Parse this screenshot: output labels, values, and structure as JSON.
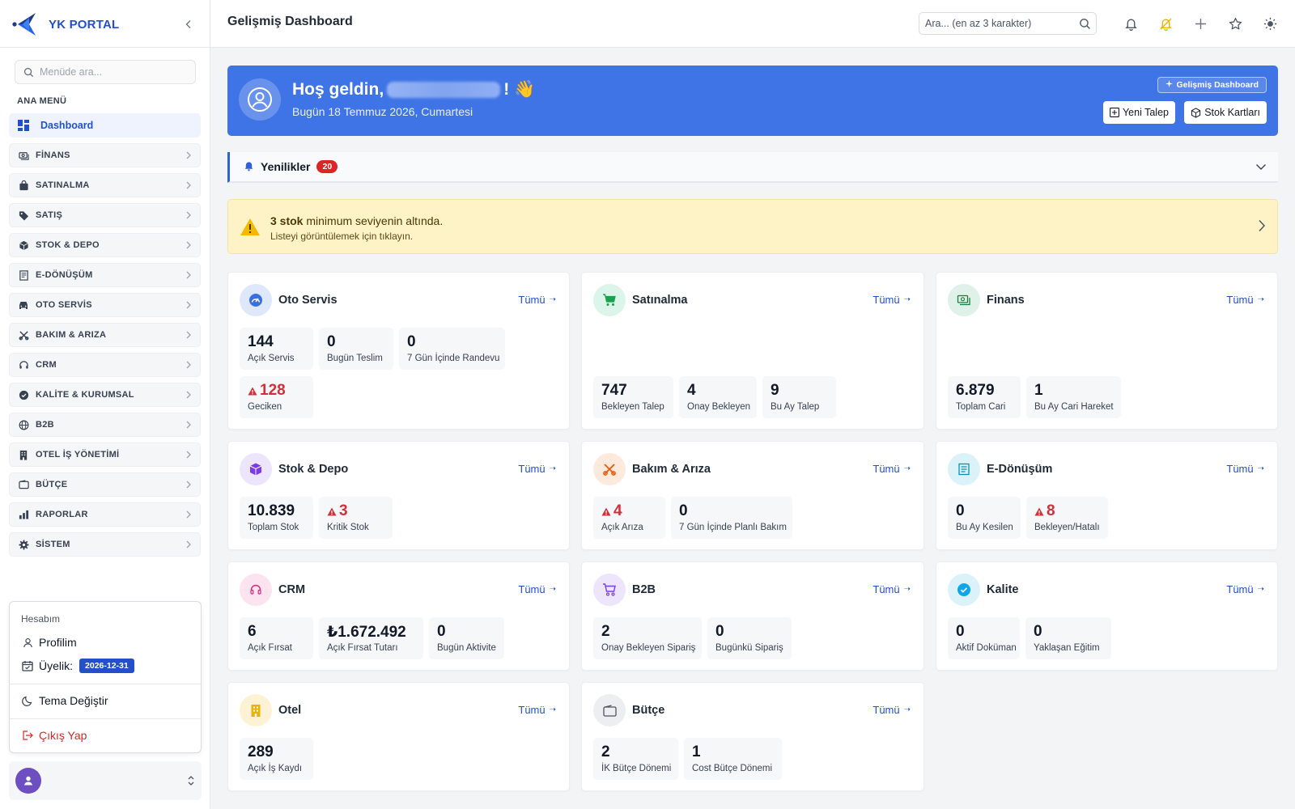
{
  "brand": {
    "name": "YK PORTAL"
  },
  "sidebar": {
    "search_placeholder": "Menüde ara...",
    "section_title": "ANA MENÜ",
    "items": [
      {
        "label": "Dashboard",
        "icon": "grid-icon"
      },
      {
        "label": "FİNANS",
        "icon": "money-icon"
      },
      {
        "label": "SATINALMA",
        "icon": "bag-icon"
      },
      {
        "label": "SATIŞ",
        "icon": "tag-icon"
      },
      {
        "label": "STOK & DEPO",
        "icon": "box-icon"
      },
      {
        "label": "E-DÖNÜŞÜM",
        "icon": "receipt-icon"
      },
      {
        "label": "OTO SERVİS",
        "icon": "car-icon"
      },
      {
        "label": "BAKIM & ARIZA",
        "icon": "tools-icon"
      },
      {
        "label": "CRM",
        "icon": "headset-icon"
      },
      {
        "label": "KALİTE & KURUMSAL",
        "icon": "badge-check-icon"
      },
      {
        "label": "B2B",
        "icon": "globe-icon"
      },
      {
        "label": "OTEL İŞ YÖNETİMİ",
        "icon": "building-icon"
      },
      {
        "label": "BÜTÇE",
        "icon": "wallet-icon"
      },
      {
        "label": "RAPORLAR",
        "icon": "bar-chart-icon"
      },
      {
        "label": "SİSTEM",
        "icon": "gear-icon"
      }
    ]
  },
  "account": {
    "title": "Hesabım",
    "profile": "Profilim",
    "membership_label": "Üyelik:",
    "membership_date": "2026-12-31",
    "theme": "Tema Değiştir",
    "logout": "Çıkış Yap"
  },
  "topbar": {
    "title": "Gelişmiş Dashboard",
    "search_placeholder": "Ara... (en az 3 karakter)"
  },
  "hero": {
    "greeting": "Hoş geldin,",
    "exclaim": "! 👋",
    "date": "Bugün 18 Temmuz 2026, Cumartesi",
    "tag": "Gelişmiş Dashboard",
    "btn_new": "Yeni Talep",
    "btn_stock": "Stok Kartları"
  },
  "news": {
    "title": "Yenilikler",
    "count": "20"
  },
  "alert": {
    "bold": "3 stok",
    "text": " minimum seviyenin altında.",
    "sub": "Listeyi görüntülemek için tıklayın."
  },
  "link_label": "Tümü",
  "colors": {
    "primary": "#2350c9",
    "hero": "#3f74e7",
    "danger": "#d32f3a",
    "warning_bg": "#fdf3c7"
  },
  "cards": {
    "oto": {
      "title": "Oto Servis",
      "s1v": "144",
      "s1l": "Açık Servis",
      "s2v": "0",
      "s2l": "Bugün Teslim",
      "s3v": "0",
      "s3l": "7 Gün İçinde Randevu",
      "s4v": "128",
      "s4l": "Geciken"
    },
    "satin": {
      "title": "Satınalma",
      "s1v": "747",
      "s1l": "Bekleyen Talep",
      "s2v": "4",
      "s2l": "Onay Bekleyen",
      "s3v": "9",
      "s3l": "Bu Ay Talep"
    },
    "finans": {
      "title": "Finans",
      "s1v": "6.879",
      "s1l": "Toplam Cari",
      "s2v": "1",
      "s2l": "Bu Ay Cari Hareket"
    },
    "stok": {
      "title": "Stok & Depo",
      "s1v": "10.839",
      "s1l": "Toplam Stok",
      "s2v": "3",
      "s2l": "Kritik Stok"
    },
    "bakim": {
      "title": "Bakım & Arıza",
      "s1v": "4",
      "s1l": "Açık Arıza",
      "s2v": "0",
      "s2l": "7 Gün İçinde Planlı Bakım"
    },
    "edon": {
      "title": "E-Dönüşüm",
      "s1v": "0",
      "s1l": "Bu Ay Kesilen",
      "s2v": "8",
      "s2l": "Bekleyen/Hatalı"
    },
    "crm": {
      "title": "CRM",
      "s1v": "6",
      "s1l": "Açık Fırsat",
      "s2v": "₺1.672.492",
      "s2l": "Açık Fırsat Tutarı",
      "s3v": "0",
      "s3l": "Bugün Aktivite"
    },
    "b2b": {
      "title": "B2B",
      "s1v": "2",
      "s1l": "Onay Bekleyen Sipariş",
      "s2v": "0",
      "s2l": "Bugünkü Sipariş"
    },
    "kalite": {
      "title": "Kalite",
      "s1v": "0",
      "s1l": "Aktif Doküman",
      "s2v": "0",
      "s2l": "Yaklaşan Eğitim"
    },
    "otel": {
      "title": "Otel",
      "s1v": "289",
      "s1l": "Açık İş Kaydı"
    },
    "butce": {
      "title": "Bütçe",
      "s1v": "2",
      "s1l": "İK Bütçe Dönemi",
      "s2v": "1",
      "s2l": "Cost Bütçe Dönemi"
    }
  }
}
